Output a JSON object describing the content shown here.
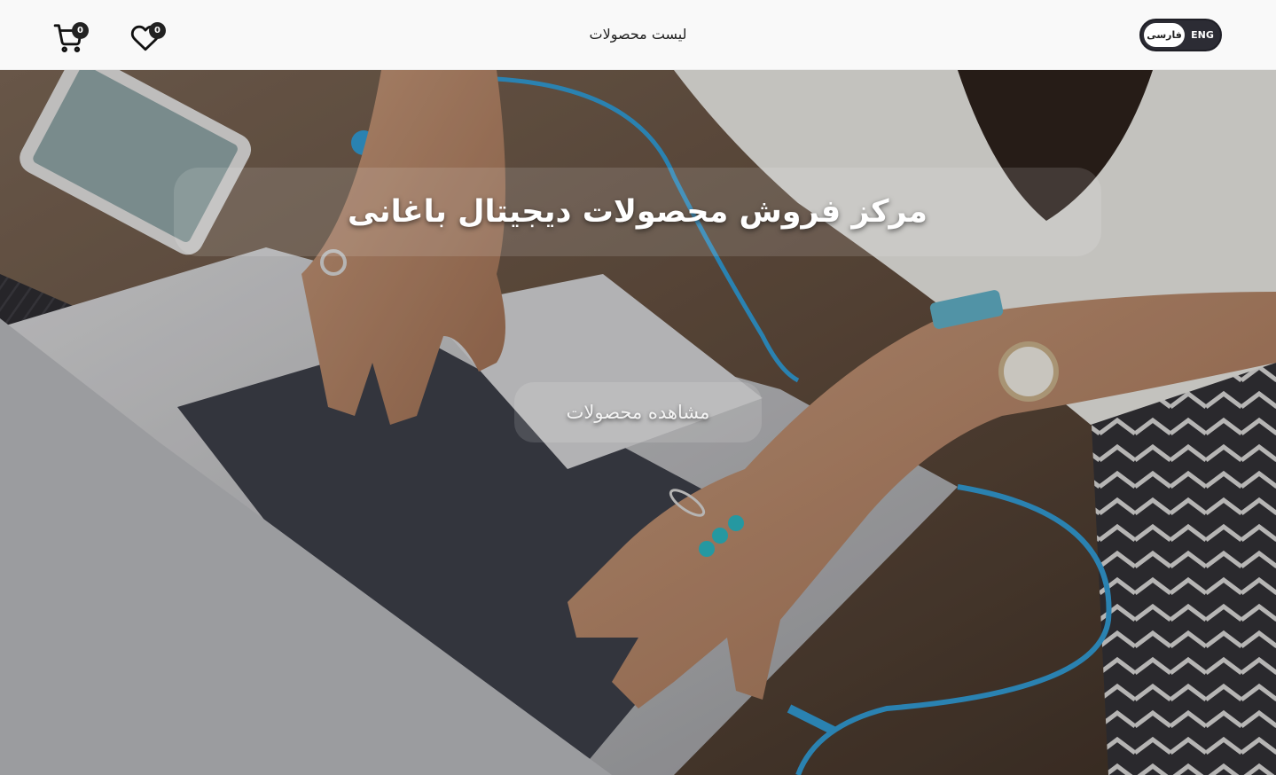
{
  "navbar": {
    "title": "لیست محصولات",
    "cart": {
      "count": "0",
      "icon": "cart-icon"
    },
    "wishlist": {
      "count": "0",
      "icon": "heart-icon"
    },
    "language": {
      "farsi_label": "فارسی",
      "english_label": "ENG",
      "active": "فارسی"
    }
  },
  "hero": {
    "title": "مرکز فروش محصولات دیجیتال باغانی",
    "cta_label": "مشاهده محصولات"
  },
  "colors": {
    "navbar_bg": "#f9f9f9",
    "toggle_bg": "#2c2c34",
    "badge_bg": "#222222",
    "accent_cable": "#2f9bd6"
  }
}
